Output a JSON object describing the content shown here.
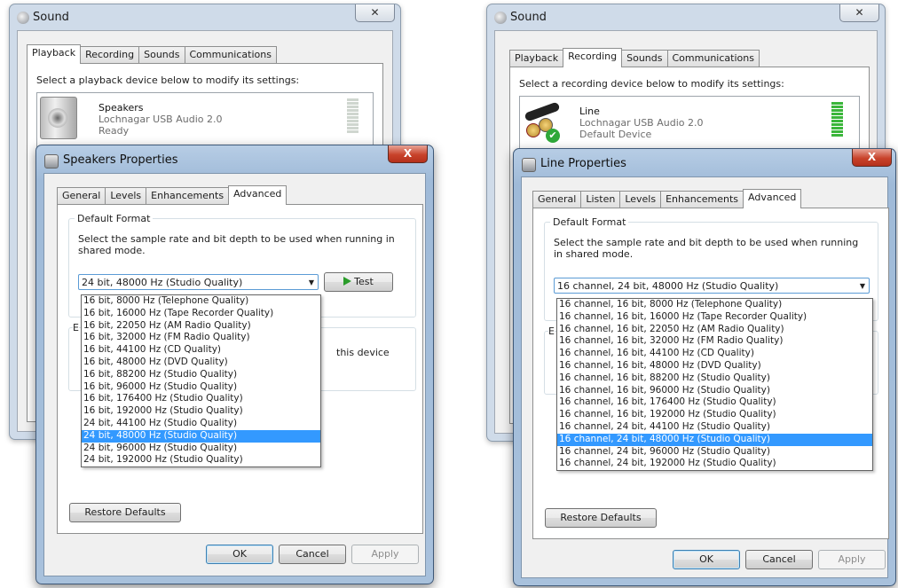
{
  "left": {
    "sound_window": {
      "title": "Sound",
      "close_glyph": "✕",
      "tabs": [
        "Playback",
        "Recording",
        "Sounds",
        "Communications"
      ],
      "active_tab": "Playback",
      "instruction": "Select a playback device below to modify its settings:",
      "device": {
        "name": "Speakers",
        "driver": "Lochnagar USB Audio 2.0",
        "status": "Ready"
      }
    },
    "properties": {
      "title": "Speakers Properties",
      "close_glyph": "X",
      "tabs": [
        "General",
        "Levels",
        "Enhancements",
        "Advanced"
      ],
      "active_tab": "Advanced",
      "group_label": "Default Format",
      "group_text": "Select the sample rate and bit depth to be used when running in shared mode.",
      "selected": "24 bit, 48000 Hz (Studio Quality)",
      "test_label": "Test",
      "options": [
        "16 bit, 8000 Hz (Telephone Quality)",
        "16 bit, 16000 Hz (Tape Recorder Quality)",
        "16 bit, 22050 Hz (AM Radio Quality)",
        "16 bit, 32000 Hz (FM Radio Quality)",
        "16 bit, 44100 Hz (CD Quality)",
        "16 bit, 48000 Hz (DVD Quality)",
        "16 bit, 88200 Hz (Studio Quality)",
        "16 bit, 96000 Hz (Studio Quality)",
        "16 bit, 176400 Hz (Studio Quality)",
        "16 bit, 192000 Hz (Studio Quality)",
        "24 bit, 44100 Hz (Studio Quality)",
        "24 bit, 48000 Hz (Studio Quality)",
        "24 bit, 96000 Hz (Studio Quality)",
        "24 bit, 192000 Hz (Studio Quality)"
      ],
      "selected_index": 11,
      "exclusive_fragment": "E",
      "this_device_fragment": "this device",
      "restore_label": "Restore Defaults",
      "ok_label": "OK",
      "cancel_label": "Cancel",
      "apply_label": "Apply"
    }
  },
  "right": {
    "sound_window": {
      "title": "Sound",
      "close_glyph": "✕",
      "tabs": [
        "Playback",
        "Recording",
        "Sounds",
        "Communications"
      ],
      "active_tab": "Recording",
      "instruction": "Select a recording device below to modify its settings:",
      "device": {
        "name": "Line",
        "driver": "Lochnagar USB Audio 2.0",
        "status": "Default Device"
      }
    },
    "properties": {
      "title": "Line Properties",
      "close_glyph": "X",
      "tabs": [
        "General",
        "Listen",
        "Levels",
        "Enhancements",
        "Advanced"
      ],
      "active_tab": "Advanced",
      "group_label": "Default Format",
      "group_text": "Select the sample rate and bit depth to be used when running in shared mode.",
      "selected": "16 channel, 24 bit, 48000 Hz (Studio Quality)",
      "options": [
        "16 channel, 16 bit, 8000 Hz (Telephone Quality)",
        "16 channel, 16 bit, 16000 Hz (Tape Recorder Quality)",
        "16 channel, 16 bit, 22050 Hz (AM Radio Quality)",
        "16 channel, 16 bit, 32000 Hz (FM Radio Quality)",
        "16 channel, 16 bit, 44100 Hz (CD Quality)",
        "16 channel, 16 bit, 48000 Hz (DVD Quality)",
        "16 channel, 16 bit, 88200 Hz (Studio Quality)",
        "16 channel, 16 bit, 96000 Hz (Studio Quality)",
        "16 channel, 16 bit, 176400 Hz (Studio Quality)",
        "16 channel, 16 bit, 192000 Hz (Studio Quality)",
        "16 channel, 24 bit, 44100 Hz (Studio Quality)",
        "16 channel, 24 bit, 48000 Hz (Studio Quality)",
        "16 channel, 24 bit, 96000 Hz (Studio Quality)",
        "16 channel, 24 bit, 192000 Hz (Studio Quality)"
      ],
      "selected_index": 11,
      "exclusive_fragment": "E",
      "restore_label": "Restore Defaults",
      "ok_label": "OK",
      "cancel_label": "Cancel",
      "apply_label": "Apply"
    }
  },
  "colors": {
    "selection": "#3399ff",
    "meter_active": "#3bb63b",
    "close_red": "#c8432b"
  }
}
